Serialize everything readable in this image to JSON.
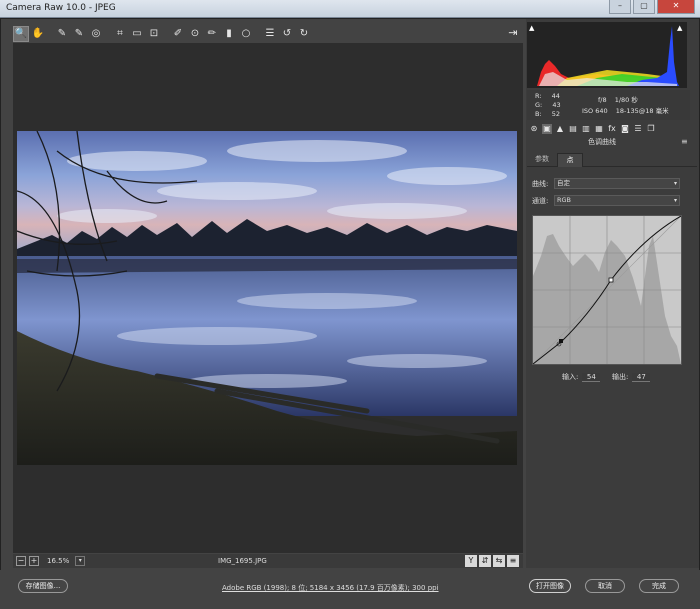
{
  "window": {
    "title": "Camera Raw 10.0 - JPEG",
    "buttons": [
      "–",
      "▢",
      "✕"
    ]
  },
  "toolbar": {
    "tools": [
      {
        "name": "zoom-tool",
        "icon": "zoom-icon",
        "glyph": "🔍"
      },
      {
        "name": "hand-tool",
        "icon": "hand-icon",
        "glyph": "✋"
      },
      {
        "name": "white-balance-tool",
        "icon": "eyedropper-icon",
        "glyph": "✎"
      },
      {
        "name": "color-sampler-tool",
        "icon": "color-sampler-icon",
        "glyph": "✎"
      },
      {
        "name": "target-adjust-tool",
        "icon": "target-adjust-icon",
        "glyph": "◎"
      },
      {
        "name": "crop-tool",
        "icon": "crop-icon",
        "glyph": "⌗"
      },
      {
        "name": "straighten-tool",
        "icon": "straighten-icon",
        "glyph": "▭"
      },
      {
        "name": "transform-tool",
        "icon": "transform-icon",
        "glyph": "⊡"
      },
      {
        "name": "spot-removal-tool",
        "icon": "brush-heal-icon",
        "glyph": "✐"
      },
      {
        "name": "red-eye-tool",
        "icon": "eye-icon",
        "glyph": "⊙"
      },
      {
        "name": "adjustment-brush-tool",
        "icon": "brush-icon",
        "glyph": "✏"
      },
      {
        "name": "graduated-filter-tool",
        "icon": "graduated-filter-icon",
        "glyph": "▮"
      },
      {
        "name": "radial-filter-tool",
        "icon": "radial-filter-icon",
        "glyph": "○"
      },
      {
        "name": "preferences-button",
        "icon": "list-icon",
        "glyph": "☰"
      },
      {
        "name": "rotate-left-button",
        "icon": "rotate-left-icon",
        "glyph": "↺"
      },
      {
        "name": "rotate-right-button",
        "icon": "rotate-right-icon",
        "glyph": "↻"
      }
    ],
    "toggle_glyph": "⇥"
  },
  "histogram": {
    "readout_labels": [
      "R:",
      "G:",
      "B:"
    ],
    "readout_values": [
      "44",
      "43",
      "52"
    ],
    "aperture": "f/8",
    "shutter": "1/80 秒",
    "iso": "ISO 640",
    "lens": "18-135@18 毫米"
  },
  "panel_tabs": [
    "⊛",
    "▣",
    "▲",
    "▤",
    "▥",
    "▦",
    "fx",
    "◙",
    "☰",
    "❐"
  ],
  "section_title": "色调曲线",
  "subtabs": [
    "参数",
    "点"
  ],
  "curve": {
    "curve_label": "曲线:",
    "curve_value": "自定",
    "channel_label": "通道:",
    "channel_value": "RGB",
    "input_label": "输入:",
    "input_value": "54",
    "output_label": "输出:",
    "output_value": "47"
  },
  "statusbar": {
    "zoom": "16.5%",
    "filename": "IMG_1695.JPG",
    "zoom_minus": "−",
    "zoom_plus": "+",
    "right_icons": [
      "Y",
      "⇵",
      "⇆",
      "≡"
    ]
  },
  "bottom": {
    "save_label": "存储图像...",
    "workflow": "Adobe RGB (1998); 8 位; 5184 x 3456 (17.9 百万像素); 300 ppi",
    "open_label": "打开图像",
    "cancel_label": "取消",
    "done_label": "完成"
  }
}
